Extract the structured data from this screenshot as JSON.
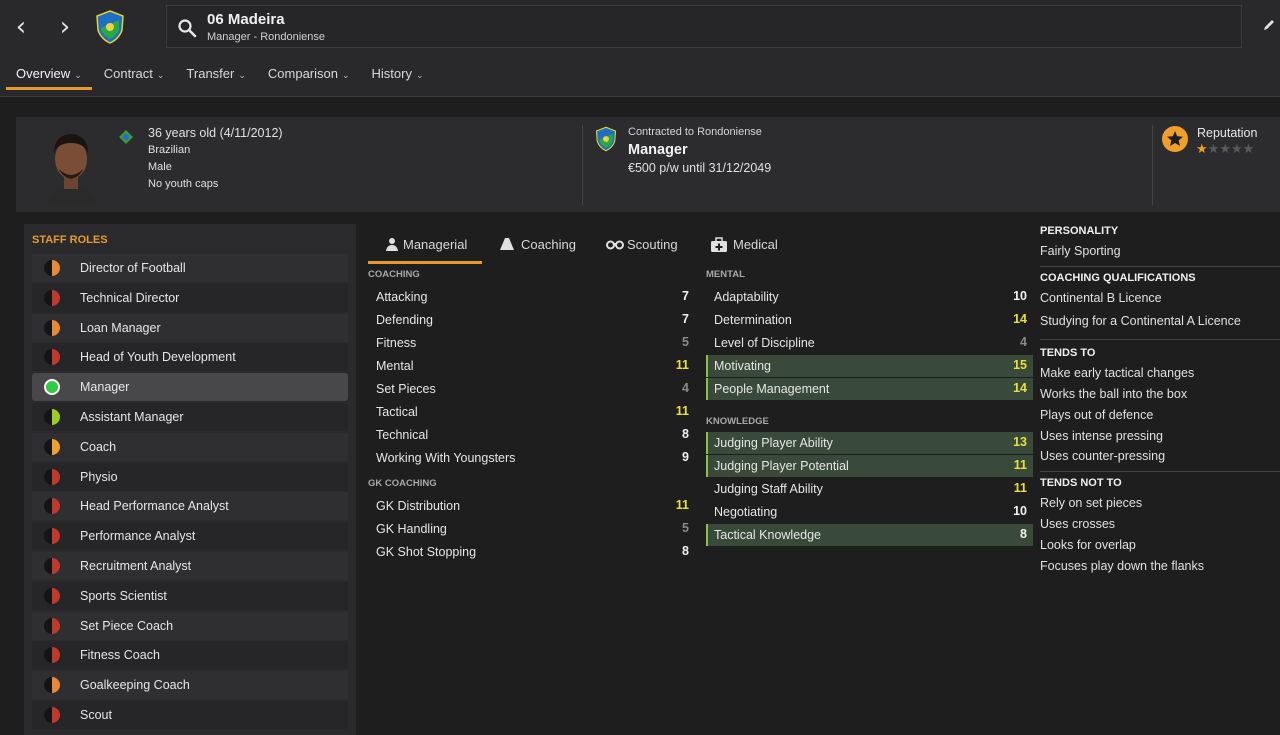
{
  "header": {
    "name": "06 Madeira",
    "subtitle": "Manager - Rondoniense",
    "tabs": [
      {
        "label": "Overview",
        "active": true
      },
      {
        "label": "Contract"
      },
      {
        "label": "Transfer"
      },
      {
        "label": "Comparison"
      },
      {
        "label": "History"
      }
    ]
  },
  "profile": {
    "age": "36 years old (4/11/2012)",
    "nationality": "Brazilian",
    "gender": "Male",
    "caps": "No youth caps",
    "contract_label": "Contracted to Rondoniense",
    "role": "Manager",
    "wage": "€500 p/w until 31/12/2049",
    "reputation_label": "Reputation",
    "reputation_stars": 1,
    "reputation_max": 5
  },
  "staff_roles": {
    "title": "STAFF ROLES",
    "items": [
      {
        "label": "Director of Football",
        "color": "#e8893a"
      },
      {
        "label": "Technical Director",
        "color": "#c0392b"
      },
      {
        "label": "Loan Manager",
        "color": "#e8893a"
      },
      {
        "label": "Head of Youth Development",
        "color": "#c0392b"
      },
      {
        "label": "Manager",
        "color": "#2ecc40",
        "active": true
      },
      {
        "label": "Assistant Manager",
        "color": "#9ccc25"
      },
      {
        "label": "Coach",
        "color": "#f0a030"
      },
      {
        "label": "Physio",
        "color": "#c0392b"
      },
      {
        "label": "Head Performance Analyst",
        "color": "#c0392b"
      },
      {
        "label": "Performance Analyst",
        "color": "#c0392b"
      },
      {
        "label": "Recruitment Analyst",
        "color": "#c0392b"
      },
      {
        "label": "Sports Scientist",
        "color": "#c0392b"
      },
      {
        "label": "Set Piece Coach",
        "color": "#c0392b"
      },
      {
        "label": "Fitness Coach",
        "color": "#c0392b"
      },
      {
        "label": "Goalkeeping Coach",
        "color": "#e8893a"
      },
      {
        "label": "Scout",
        "color": "#c0392b"
      }
    ]
  },
  "attr_tabs": [
    {
      "label": "Managerial",
      "active": true,
      "icon": "manager-icon"
    },
    {
      "label": "Coaching",
      "icon": "cone-icon"
    },
    {
      "label": "Scouting",
      "icon": "binoculars-icon"
    },
    {
      "label": "Medical",
      "icon": "medical-kit-icon"
    }
  ],
  "coaching": {
    "title": "COACHING",
    "rows": [
      {
        "name": "Attacking",
        "value": "7",
        "tone": "w"
      },
      {
        "name": "Defending",
        "value": "7",
        "tone": "w"
      },
      {
        "name": "Fitness",
        "value": "5",
        "tone": "g"
      },
      {
        "name": "Mental",
        "value": "11",
        "tone": "y"
      },
      {
        "name": "Set Pieces",
        "value": "4",
        "tone": "g"
      },
      {
        "name": "Tactical",
        "value": "11",
        "tone": "y"
      },
      {
        "name": "Technical",
        "value": "8",
        "tone": "w"
      },
      {
        "name": "Working With Youngsters",
        "value": "9",
        "tone": "w"
      }
    ]
  },
  "gk_coaching": {
    "title": "GK COACHING",
    "rows": [
      {
        "name": "GK Distribution",
        "value": "11",
        "tone": "y"
      },
      {
        "name": "GK Handling",
        "value": "5",
        "tone": "g"
      },
      {
        "name": "GK Shot Stopping",
        "value": "8",
        "tone": "w"
      }
    ]
  },
  "mental": {
    "title": "MENTAL",
    "rows": [
      {
        "name": "Adaptability",
        "value": "10",
        "tone": "w"
      },
      {
        "name": "Determination",
        "value": "14",
        "tone": "y"
      },
      {
        "name": "Level of Discipline",
        "value": "4",
        "tone": "g"
      },
      {
        "name": "Motivating",
        "value": "15",
        "tone": "y",
        "hl": true
      },
      {
        "name": "People Management",
        "value": "14",
        "tone": "y",
        "hl": true
      }
    ]
  },
  "knowledge": {
    "title": "KNOWLEDGE",
    "rows": [
      {
        "name": "Judging Player Ability",
        "value": "13",
        "tone": "y",
        "hl": true
      },
      {
        "name": "Judging Player Potential",
        "value": "11",
        "tone": "y",
        "hl": true
      },
      {
        "name": "Judging Staff Ability",
        "value": "11",
        "tone": "y"
      },
      {
        "name": "Negotiating",
        "value": "10",
        "tone": "w"
      },
      {
        "name": "Tactical Knowledge",
        "value": "8",
        "tone": "w",
        "hl": true
      }
    ]
  },
  "side": {
    "personality_title": "PERSONALITY",
    "personality": "Fairly Sporting",
    "quals_title": "COACHING QUALIFICATIONS",
    "quals": [
      "Continental B Licence",
      "Studying for a Continental A Licence"
    ],
    "tends_title": "TENDS TO",
    "tends": [
      "Make early tactical changes",
      "Works the ball into the box",
      "Plays out of defence",
      "Uses intense pressing",
      "Uses counter-pressing"
    ],
    "tends_not_title": "TENDS NOT TO",
    "tends_not": [
      "Rely on set pieces",
      "Uses crosses",
      "Looks for overlap",
      "Focuses play down the flanks"
    ]
  }
}
